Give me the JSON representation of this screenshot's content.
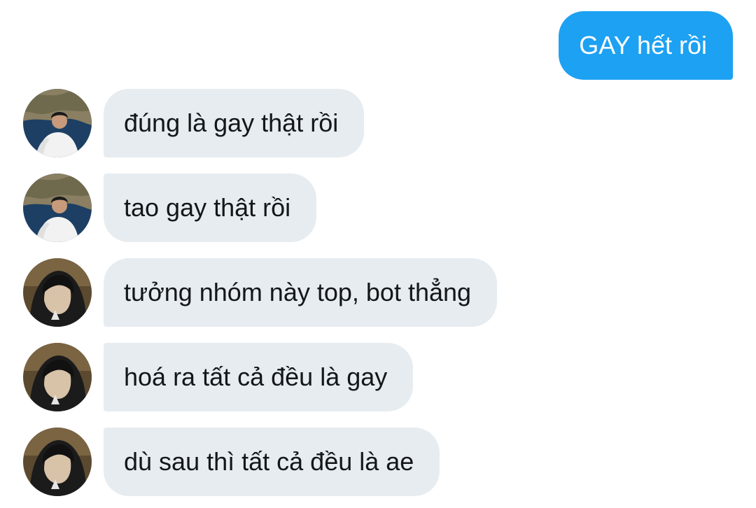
{
  "conversation": {
    "sent_message": "GAY hết rồi",
    "received_messages": [
      {
        "text": "đúng là gay thật rồi",
        "sender_avatar": "outdoor-man-avatar"
      },
      {
        "text": "tao gay thật rồi",
        "sender_avatar": "outdoor-man-avatar"
      },
      {
        "text": "tưởng nhóm này top, bot thẳng",
        "sender_avatar": "hooded-person-avatar"
      },
      {
        "text": "hoá ra tất cả đều là gay",
        "sender_avatar": "hooded-person-avatar"
      },
      {
        "text": "dù sau thì tất cả đều là ae",
        "sender_avatar": "hooded-person-avatar"
      }
    ]
  },
  "colors": {
    "sent_bubble": "#1da1f2",
    "received_bubble": "#e6ecf0",
    "received_text": "#14171a",
    "background": "#ffffff"
  }
}
